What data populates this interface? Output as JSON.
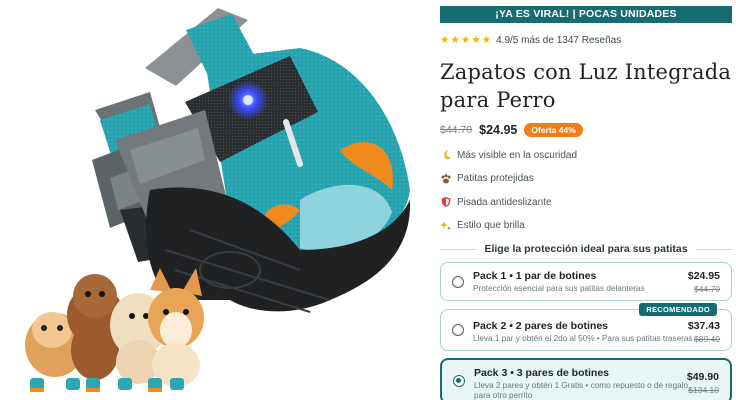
{
  "promo": {
    "banner": "¡YA ES VIRAL! | POCAS UNIDADES"
  },
  "rating": {
    "stars": 5,
    "text": "4.9/5 más de 1347 Reseñas"
  },
  "product": {
    "title_line1": "Zapatos con Luz Integrada",
    "title_line2": "para Perro",
    "price_old": "$44.70",
    "price_new": "$24.95",
    "offer_badge": "Oferta 44%"
  },
  "features": [
    {
      "icon": "moon-icon",
      "label": "Más visible en la oscuridad"
    },
    {
      "icon": "paw-icon",
      "label": "Patitas protejidas"
    },
    {
      "icon": "shield-icon",
      "label": "Pisada antideslizante"
    },
    {
      "icon": "sparkles-icon",
      "label": "Estilo que brilla"
    }
  ],
  "bundles_title": "Elige la protección ideal para sus patitas",
  "bundles": [
    {
      "name_prefix": "Pack 1 • ",
      "name_rest": "1 par de botines",
      "desc_line1": "Protección esencial para sus patitas delanteras",
      "desc_line2": "",
      "price": "$24.95",
      "old_price": "$44.70",
      "badge": "",
      "selected": false
    },
    {
      "name_prefix": "Pack 2 • ",
      "name_rest": "2 pares de botines",
      "desc_line1": "Lleva 1 par y obtén el 2do al 50% • Para sus patitas traseras",
      "desc_line2": "",
      "price": "$37.43",
      "old_price": "$89.40",
      "badge": "RECOMENDADO",
      "selected": false
    },
    {
      "name_prefix": "Pack 3 • ",
      "name_rest": "3 pares de botines",
      "desc_line1": "Lleva 2 pares y obtén 1 Gratis • como repuesto o de regalo",
      "desc_line2": "para otro perrito",
      "price": "$49.90",
      "old_price": "$134.10",
      "badge": "",
      "selected": true
    }
  ],
  "colors": {
    "brand_teal": "#176c70",
    "offer_orange": "#f07d16",
    "star_yellow": "#f5b400",
    "boot_teal": "#2aa9b5",
    "boot_orange": "#f08a1c",
    "led_blue": "#3a4bff"
  }
}
